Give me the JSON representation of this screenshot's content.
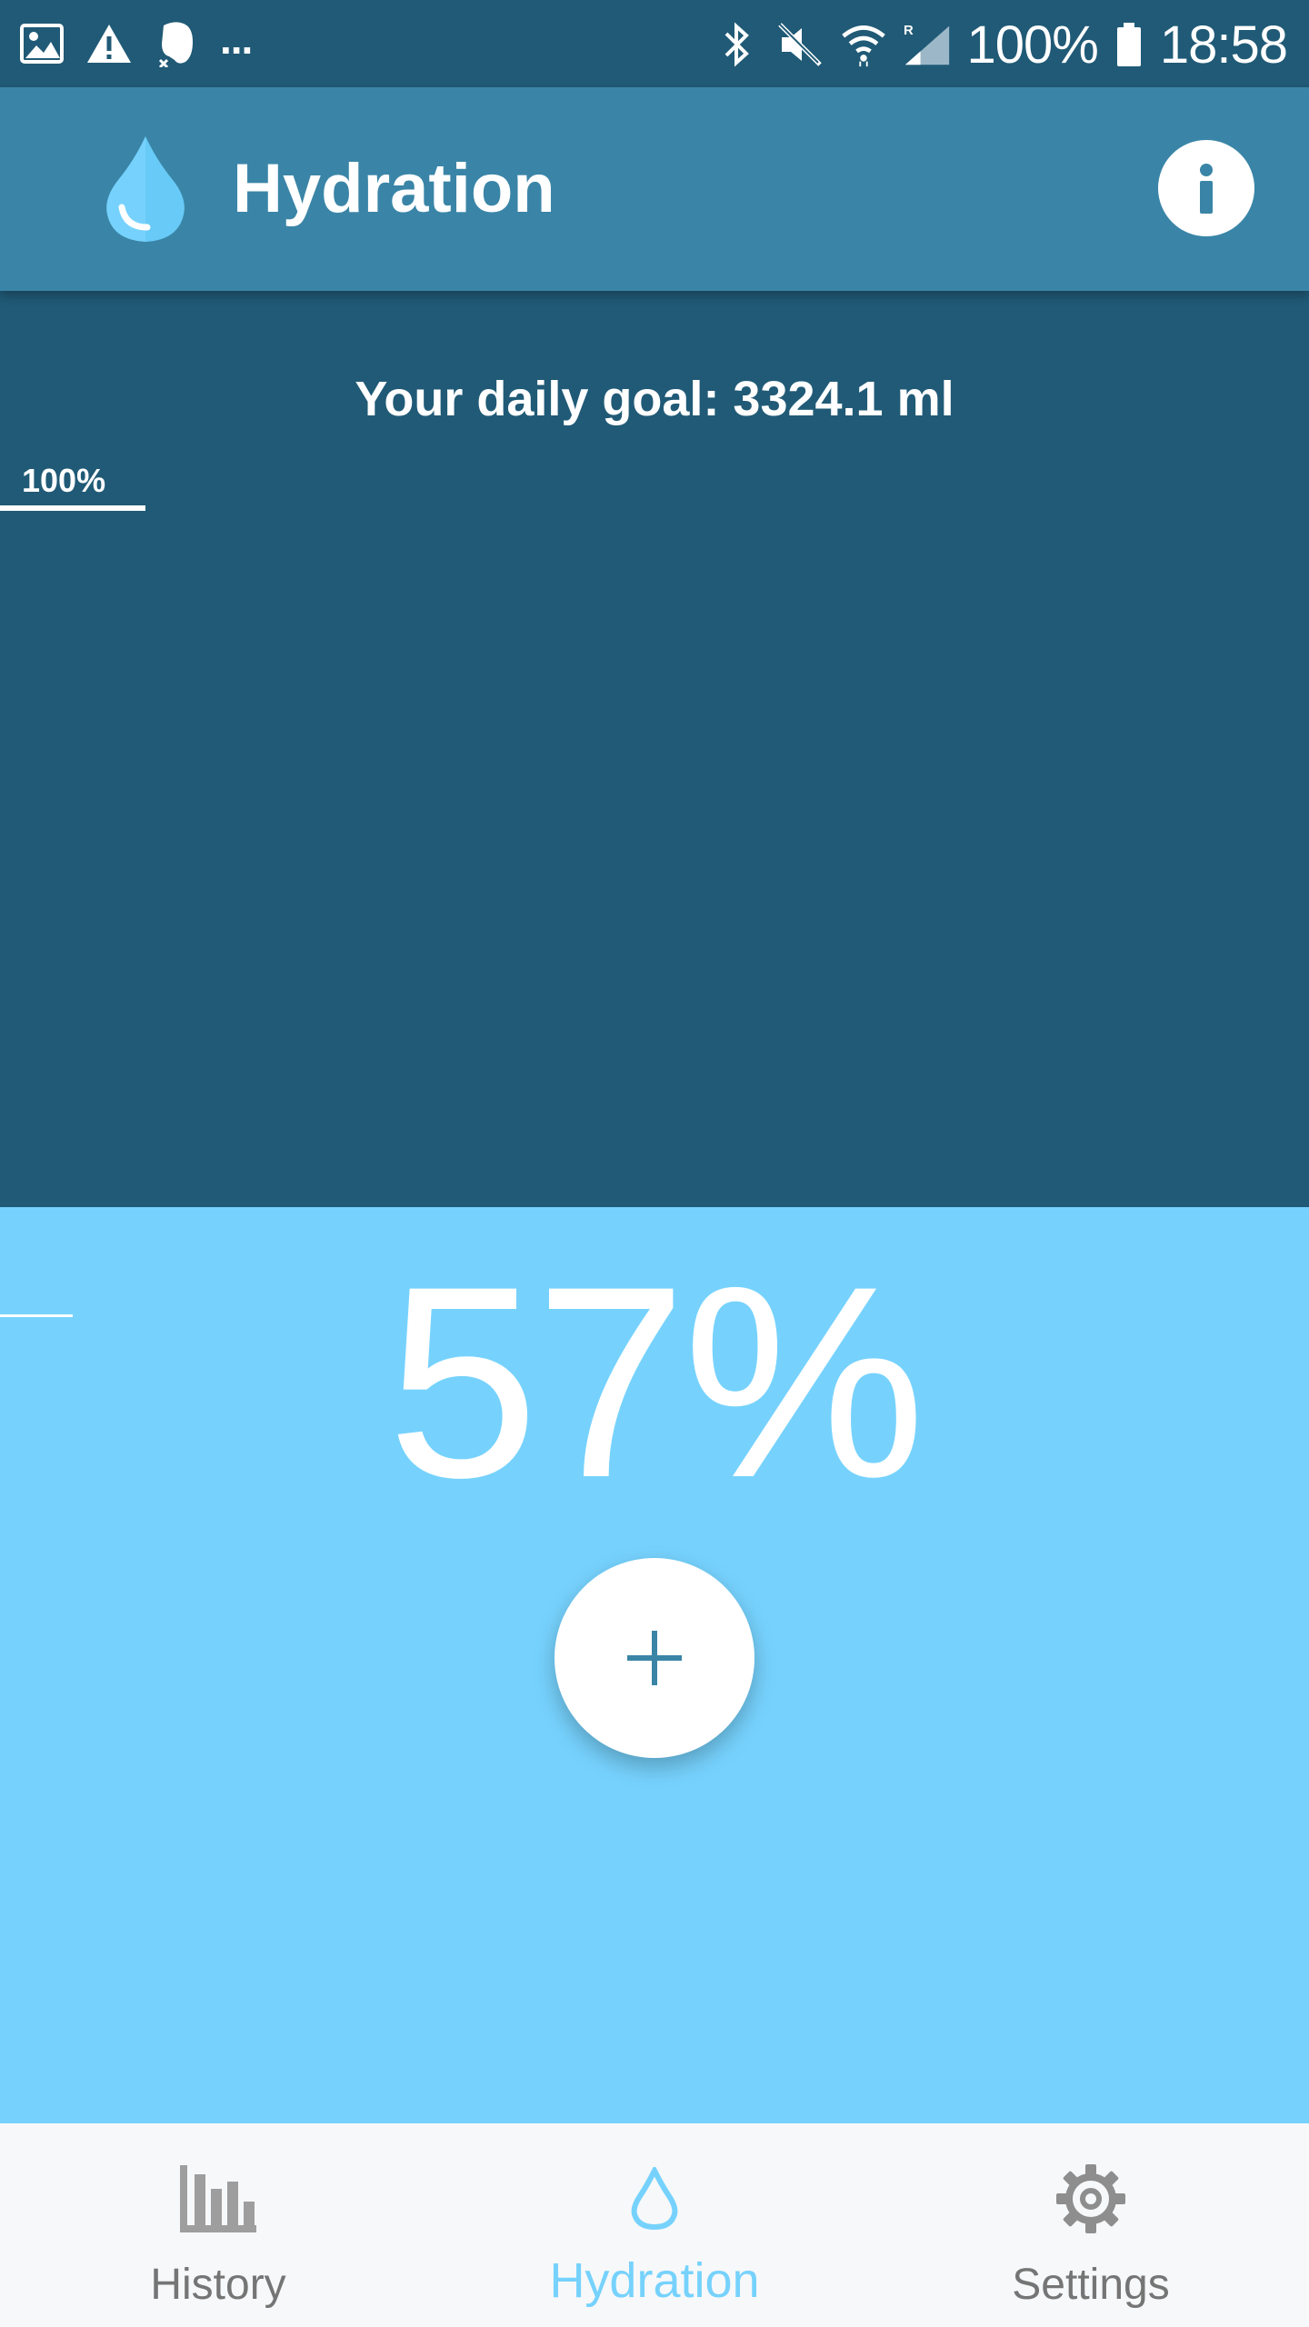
{
  "status_bar": {
    "battery": "100%",
    "time": "18:58",
    "overflow": "..."
  },
  "app_bar": {
    "title": "Hydration",
    "logo_icon": "water-drop-icon",
    "info_icon": "info-icon"
  },
  "main": {
    "daily_goal": "Your daily goal: 3324.1 ml",
    "goal_marker_label": "100%",
    "progress_percent": "57%",
    "progress_value": 0.57,
    "add_icon": "plus-icon"
  },
  "colors": {
    "status_bar": "#205a76",
    "app_bar": "#3a85a7",
    "background": "#205a76",
    "water": "#76d2fd",
    "accent": "#76d2fd",
    "nav_inactive": "#7d7d7d"
  },
  "bottom_nav": {
    "items": [
      {
        "label": "History",
        "icon": "bar-chart-icon"
      },
      {
        "label": "Hydration",
        "icon": "water-drop-icon"
      },
      {
        "label": "Settings",
        "icon": "gear-icon"
      }
    ]
  }
}
